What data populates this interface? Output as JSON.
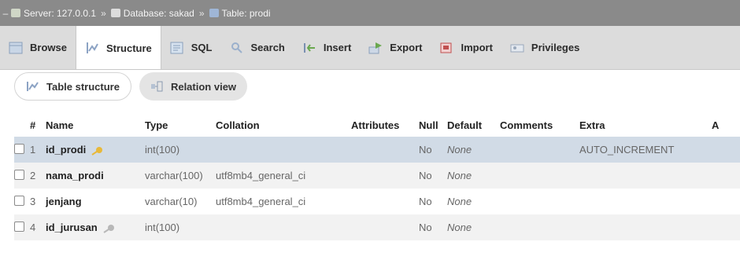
{
  "breadcrumb": {
    "server": "Server: 127.0.0.1",
    "database": "Database: sakad",
    "table": "Table: prodi",
    "separator": "»"
  },
  "tabs": [
    {
      "label": "Browse",
      "icon": "browse-icon",
      "active": false
    },
    {
      "label": "Structure",
      "icon": "structure-icon",
      "active": true
    },
    {
      "label": "SQL",
      "icon": "sql-icon",
      "active": false
    },
    {
      "label": "Search",
      "icon": "search-icon",
      "active": false
    },
    {
      "label": "Insert",
      "icon": "insert-icon",
      "active": false
    },
    {
      "label": "Export",
      "icon": "export-icon",
      "active": false
    },
    {
      "label": "Import",
      "icon": "import-icon",
      "active": false
    },
    {
      "label": "Privileges",
      "icon": "privileges-icon",
      "active": false
    }
  ],
  "subtabs": {
    "table_structure": "Table structure",
    "relation_view": "Relation view"
  },
  "table": {
    "headers": {
      "num": "#",
      "name": "Name",
      "type": "Type",
      "collation": "Collation",
      "attributes": "Attributes",
      "null": "Null",
      "default": "Default",
      "comments": "Comments",
      "extra": "Extra",
      "action": "A"
    },
    "rows": [
      {
        "num": "1",
        "name": "id_prodi",
        "key": "primary",
        "type": "int(100)",
        "collation": "",
        "attributes": "",
        "null": "No",
        "default": "None",
        "comments": "",
        "extra": "AUTO_INCREMENT"
      },
      {
        "num": "2",
        "name": "nama_prodi",
        "key": "",
        "type": "varchar(100)",
        "collation": "utf8mb4_general_ci",
        "attributes": "",
        "null": "No",
        "default": "None",
        "comments": "",
        "extra": ""
      },
      {
        "num": "3",
        "name": "jenjang",
        "key": "",
        "type": "varchar(10)",
        "collation": "utf8mb4_general_ci",
        "attributes": "",
        "null": "No",
        "default": "None",
        "comments": "",
        "extra": ""
      },
      {
        "num": "4",
        "name": "id_jurusan",
        "key": "index",
        "type": "int(100)",
        "collation": "",
        "attributes": "",
        "null": "No",
        "default": "None",
        "comments": "",
        "extra": ""
      }
    ]
  },
  "colors": {
    "breadcrumb_bg": "#8a8a8a",
    "tabs_bg": "#dcdcdc",
    "selected_row": "#d1dbe6",
    "primary_key": "#e8b93a",
    "index_key": "#b8b8b8"
  }
}
